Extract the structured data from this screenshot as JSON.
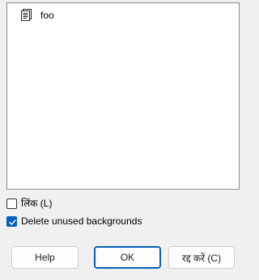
{
  "list": {
    "items": [
      {
        "label": "foo",
        "icon": "document-icon"
      }
    ]
  },
  "options": {
    "link": {
      "label": "लिंक (L)",
      "checked": false
    },
    "delete_unused": {
      "label": "Delete unused backgrounds",
      "checked": true
    }
  },
  "buttons": {
    "help_label": "Help",
    "ok_label": "OK",
    "cancel_label": "रद्द करें (C)"
  },
  "colors": {
    "accent": "#005fb8",
    "dialog_background": "#f0f0f0",
    "list_background": "#ffffff"
  }
}
